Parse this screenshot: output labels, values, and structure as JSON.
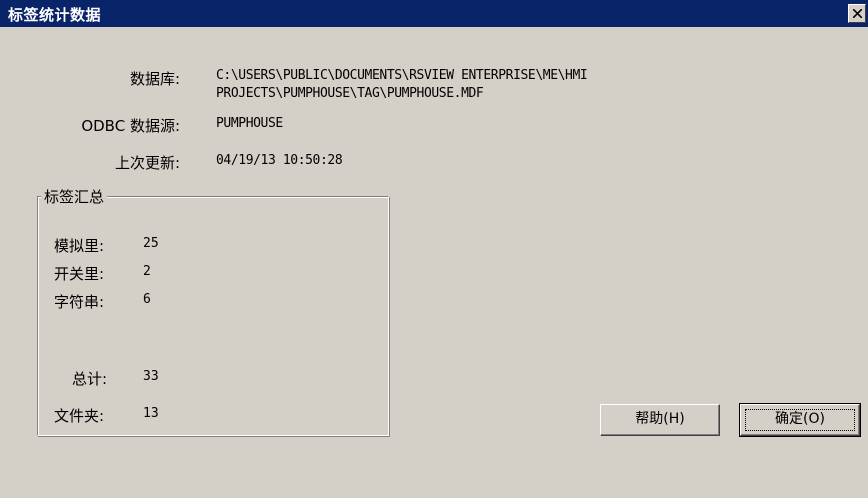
{
  "window": {
    "title": "标签统计数据"
  },
  "info": {
    "database_label": "数据库:",
    "database_line1": "C:\\USERS\\PUBLIC\\DOCUMENTS\\RSVIEW ENTERPRISE\\ME\\HMI",
    "database_line2": "PROJECTS\\PUMPHOUSE\\TAG\\PUMPHOUSE.MDF",
    "odbc_label": "ODBC 数据源:",
    "odbc_value": "PUMPHOUSE",
    "last_update_label": "上次更新:",
    "last_update_value": "04/19/13 10:50:28"
  },
  "summary": {
    "title": "标签汇总",
    "analog_label": "模拟里:",
    "analog_value": "25",
    "digital_label": "开关里:",
    "digital_value": "2",
    "string_label": "字符串:",
    "string_value": "6",
    "total_label": "总计:",
    "total_value": "33",
    "folder_label": "文件夹:",
    "folder_value": "13"
  },
  "buttons": {
    "help": "帮助(H)",
    "ok": "确定(O)"
  },
  "icons": {
    "close": "close-icon"
  }
}
